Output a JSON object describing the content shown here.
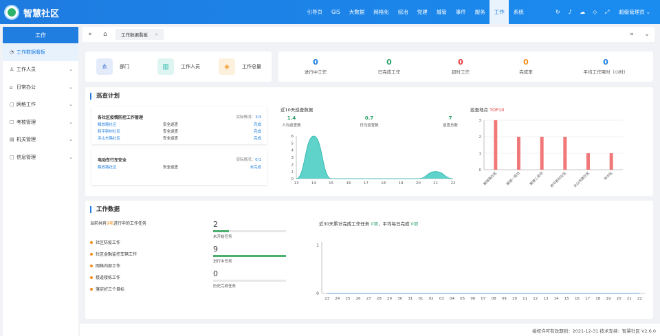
{
  "app": {
    "title": "智慧社区"
  },
  "nav": {
    "items": [
      "引导页",
      "GIS",
      "大数据",
      "网格化",
      "综治",
      "党建",
      "城管",
      "事件",
      "服务",
      "工作",
      "系统"
    ],
    "active": "工作",
    "user": "超级管理员"
  },
  "sidebar": {
    "header": "工作",
    "items": [
      {
        "label": "工作数据看板",
        "icon": "dashboard-icon",
        "active": true
      },
      {
        "label": "工作人员",
        "icon": "user-icon"
      },
      {
        "label": "日常办公",
        "icon": "home-icon"
      },
      {
        "label": "网格工作",
        "icon": "grid-icon"
      },
      {
        "label": "考核管理",
        "icon": "clipboard-icon"
      },
      {
        "label": "机关管理",
        "icon": "building-icon"
      },
      {
        "label": "信息管理",
        "icon": "info-icon"
      }
    ]
  },
  "tabs": {
    "active_tab": "工作数据看板"
  },
  "summary": {
    "left": [
      {
        "label": "部门",
        "icon": "department-icon",
        "color": "#4a78d8",
        "bg": "#e4ecfb"
      },
      {
        "label": "工作人员",
        "icon": "staff-icon",
        "color": "#2ab7a9",
        "bg": "#def5f2"
      },
      {
        "label": "工作总量",
        "icon": "layers-icon",
        "color": "#f39c2b",
        "bg": "#fdf0dc"
      }
    ],
    "right": [
      {
        "value": "0",
        "label": "进行中工作",
        "color": "#1f7ee0"
      },
      {
        "value": "0",
        "label": "已完成工作",
        "color": "#2fa36b"
      },
      {
        "value": "0",
        "label": "超时工作",
        "color": "#e6393a"
      },
      {
        "value": "0",
        "label": "完成率",
        "color": "#f08c1a"
      },
      {
        "value": "0",
        "label": "平均工作用时（小时）",
        "color": "#1f7ee0"
      }
    ]
  },
  "patrol_plan": {
    "title": "巡查计划",
    "groups": [
      {
        "name": "各社区疫情防控工作管理",
        "actual_label": "实际情况：",
        "actual_value": "3/3",
        "rows": [
          {
            "place": "解放路社区",
            "type": "安全巡查",
            "status": "完成"
          },
          {
            "place": "和平新村社区",
            "type": "安全巡查",
            "status": "完成"
          },
          {
            "place": "浜山东路社区",
            "type": "安全巡查",
            "status": "完成"
          }
        ]
      },
      {
        "name": "电动车行车安全",
        "actual_label": "实际情况：",
        "actual_value": "0/1",
        "rows": [
          {
            "place": "解放路社区",
            "type": "安全巡查",
            "status": "未完成"
          }
        ]
      }
    ],
    "recent_title": "近10天巡查数据",
    "recent_stats": [
      {
        "value": "1.4",
        "label": "人均巡查数"
      },
      {
        "value": "0.7",
        "label": "日均巡查数"
      },
      {
        "value": "7",
        "label": "巡查总数"
      }
    ],
    "top_title_prefix": "巡查地点 ",
    "top_title_suffix": "TOP10"
  },
  "work_data": {
    "title": "工作数据",
    "ongoing_prefix": "当前共有",
    "ongoing_count": "9项",
    "ongoing_suffix": "进行中的工作任务",
    "tasks": [
      "社区防疫工作",
      "社区金融监控车辆工作",
      "网格内部工作",
      "楼道楼栋工作",
      "落实好三个目标"
    ],
    "progress": [
      {
        "num": "2",
        "label": "未开始任务",
        "fraction": 0.22
      },
      {
        "num": "9",
        "label": "进行中任务",
        "fraction": 1.0
      },
      {
        "num": "0",
        "label": "历史完成任务",
        "fraction": 0
      }
    ],
    "thirty_prefix": "近30天累计完成工作任务 ",
    "thirty_count": "0项",
    "thirty_mid": "，平均每日完成 ",
    "thirty_avg": "0项"
  },
  "footer": {
    "text": "授权许可有效期到：2021-12-31 技术支持：智慧社区  V2.6.0"
  },
  "chart_data": [
    {
      "type": "area",
      "x": [
        13,
        14,
        15,
        16,
        17,
        18,
        19,
        20,
        21,
        22
      ],
      "values": [
        0,
        6,
        0,
        0,
        0,
        0,
        0,
        0,
        1,
        0
      ],
      "ylim": [
        0,
        6
      ],
      "yticks": [
        0,
        1,
        2,
        3,
        4,
        5,
        6
      ],
      "color": "#4ecdc4"
    },
    {
      "type": "bar",
      "categories": [
        "解放路社区",
        "解放一街坊",
        "解放二街坊",
        "和平新村社区",
        "浜山东路社区",
        "市中区"
      ],
      "values": [
        3,
        2,
        2,
        2,
        1,
        1
      ],
      "ylim": [
        0,
        3
      ],
      "yticks": [
        0,
        1,
        2,
        3
      ],
      "color": "#f07878"
    },
    {
      "type": "line",
      "categories": [
        "23",
        "24",
        "25",
        "26",
        "27",
        "28",
        "29",
        "30",
        "31",
        "01",
        "02",
        "03",
        "04",
        "05",
        "06",
        "07",
        "08",
        "09",
        "10",
        "11",
        "12",
        "13",
        "14",
        "15",
        "16",
        "17",
        "18",
        "19",
        "20",
        "21",
        "22"
      ],
      "values": [
        0,
        0,
        0,
        0,
        0,
        0,
        0,
        0,
        0,
        0,
        0,
        0,
        0,
        0,
        0,
        0,
        0,
        0,
        0,
        0,
        0,
        0,
        0,
        0,
        0,
        0,
        0,
        0,
        0,
        0,
        0
      ],
      "ylim": [
        0,
        1
      ],
      "yticks": [
        0,
        1
      ]
    }
  ]
}
